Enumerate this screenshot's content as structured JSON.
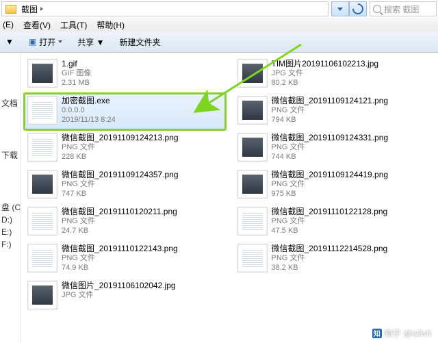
{
  "breadcrumb": {
    "current": "截图"
  },
  "search": {
    "placeholder": "搜索 截图"
  },
  "menu": {
    "edit": "(E)",
    "view": "查看(V)",
    "tools": "工具(T)",
    "help": "帮助(H)"
  },
  "cmdbar": {
    "organize": "▼",
    "open": "打开",
    "share": "共享 ▼",
    "newfolder": "新建文件夹"
  },
  "sidebar": {
    "groups": [
      "",
      "文档",
      "",
      "下载",
      "",
      "盘 (C:)",
      "D:)",
      "E:)",
      "F:)"
    ]
  },
  "files": {
    "col1": [
      {
        "name": "1.gif",
        "type": "GIF 图像",
        "size": "2.31 MB",
        "thumb": "photo"
      },
      {
        "name": "加密截图.exe",
        "type": "0.0.0.0",
        "date": "2019/11/13 8:24",
        "thumb": "doc",
        "selected": true,
        "highlight": true
      },
      {
        "name": "微信截图_20191109124213.png",
        "type": "PNG 文件",
        "size": "228 KB",
        "thumb": "doc"
      },
      {
        "name": "微信截图_20191109124357.png",
        "type": "PNG 文件",
        "size": "747 KB",
        "thumb": "photo"
      },
      {
        "name": "微信截图_20191110120211.png",
        "type": "PNG 文件",
        "size": "24.7 KB",
        "thumb": "doc"
      },
      {
        "name": "微信截图_20191110122143.png",
        "type": "PNG 文件",
        "size": "74.9 KB",
        "thumb": "doc"
      },
      {
        "name": "微信图片_20191106102042.jpg",
        "type": "JPG 文件",
        "size": "",
        "thumb": "photo"
      }
    ],
    "col2": [
      {
        "name": "TIM图片20191106102213.jpg",
        "type": "JPG 文件",
        "size": "80.2 KB",
        "thumb": "photo"
      },
      {
        "name": "微信截图_20191109124121.png",
        "type": "PNG 文件",
        "size": "794 KB",
        "thumb": "photo"
      },
      {
        "name": "微信截图_20191109124331.png",
        "type": "PNG 文件",
        "size": "744 KB",
        "thumb": "photo"
      },
      {
        "name": "微信截图_20191109124419.png",
        "type": "PNG 文件",
        "size": "975 KB",
        "thumb": "photo"
      },
      {
        "name": "微信截图_20191110122128.png",
        "type": "PNG 文件",
        "size": "47.5 KB",
        "thumb": "doc"
      },
      {
        "name": "微信截图_20191112214528.png",
        "type": "PNG 文件",
        "size": "38.2 KB",
        "thumb": "doc"
      }
    ]
  },
  "watermark": {
    "brand": "知乎",
    "handle": "@w3sft"
  }
}
